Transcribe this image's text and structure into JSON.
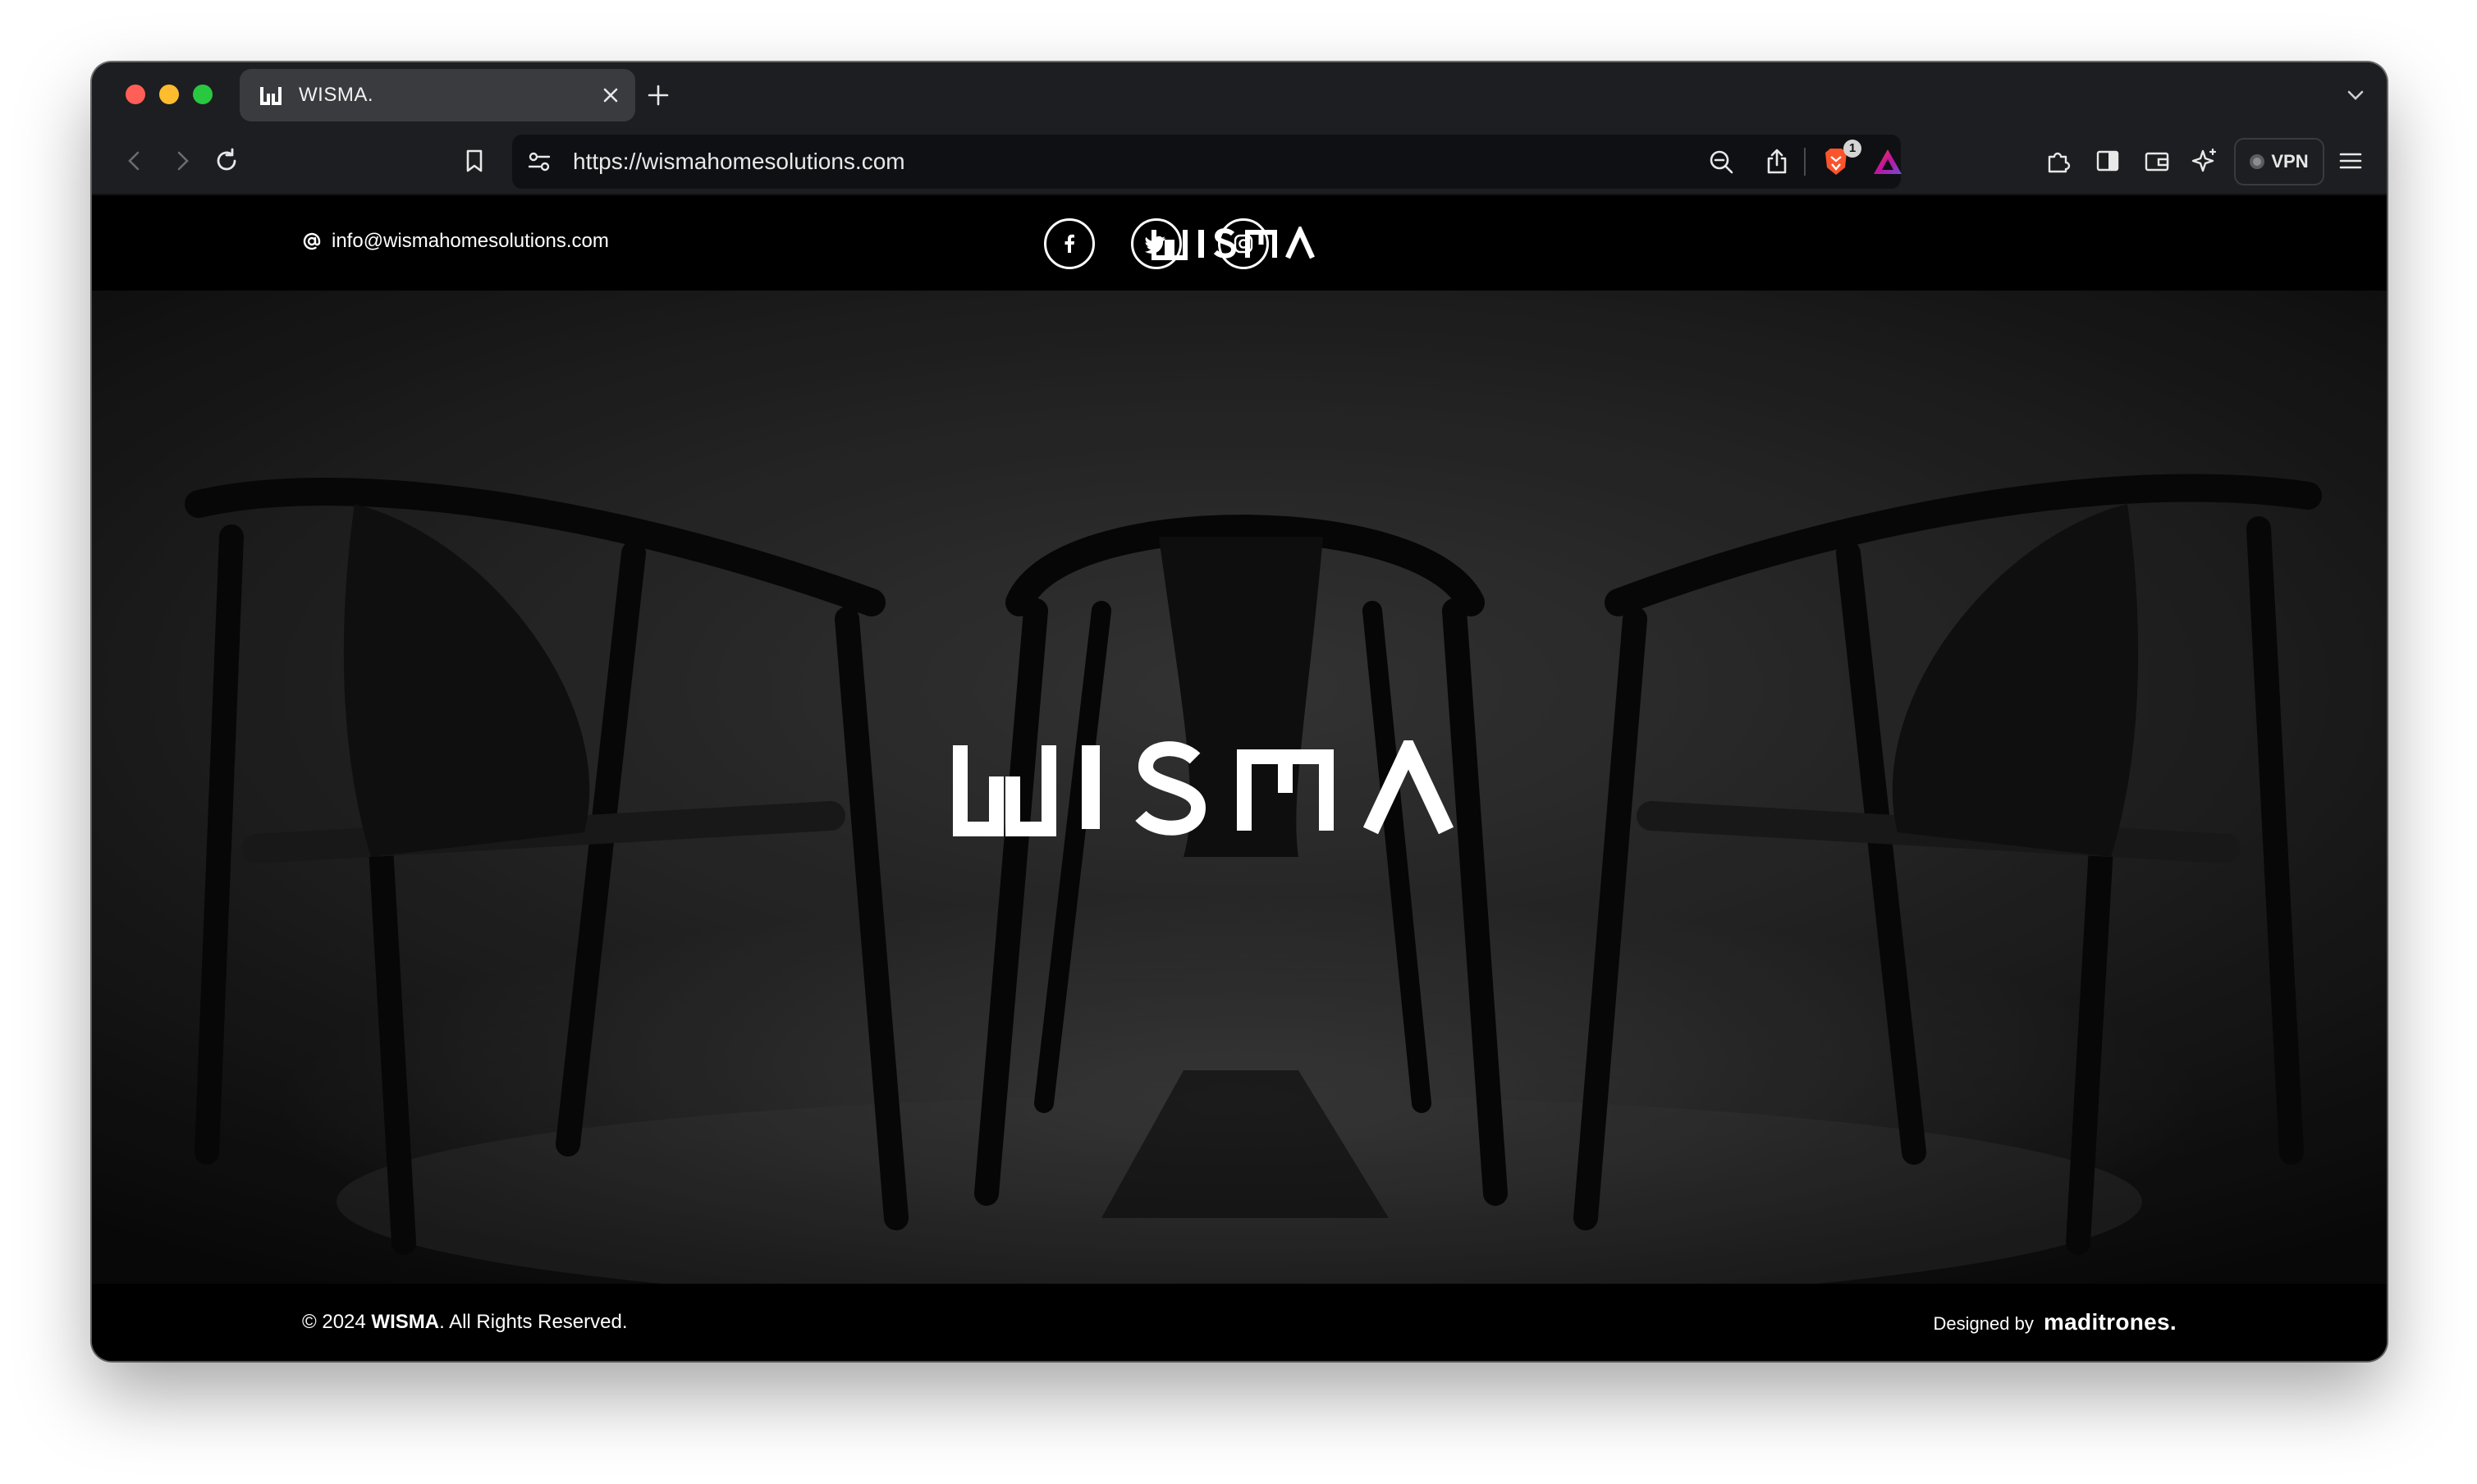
{
  "browser": {
    "tab": {
      "title": "WISMA.",
      "favicon": "wisma-w-logo"
    },
    "toolbar": {
      "url": "https://wismahomesolutions.com",
      "shields_badge": "1",
      "vpn_label": "VPN"
    },
    "icons": {
      "back": "chevron-left-icon",
      "forward": "chevron-right-icon",
      "reload": "reload-icon",
      "bookmark": "bookmark-icon",
      "site_settings": "sliders-icon",
      "zoom": "zoom-out-icon",
      "share": "share-icon",
      "shields": "brave-shields-icon",
      "rewards": "brave-rewards-icon",
      "extensions": "puzzle-icon",
      "sidebar": "sidebar-icon",
      "wallet": "wallet-icon",
      "leo": "sparkle-icon",
      "menu": "hamburger-menu-icon"
    }
  },
  "site": {
    "header": {
      "email": "info@wismahomesolutions.com",
      "logo": "WISMA",
      "social": [
        "facebook",
        "twitter",
        "instagram"
      ]
    },
    "hero": {
      "logo": "WISMA"
    },
    "footer": {
      "copyright_prefix": "© 2024",
      "copyright_brand": "WISMA",
      "copyright_suffix": ". All Rights Reserved.",
      "designed_by": "Designed by",
      "designer": "maditrones."
    }
  },
  "colors": {
    "page_bg": "#000000",
    "chrome_bg": "#1d1e21",
    "tab_active": "#3a3b3f",
    "text": "#ffffff"
  }
}
